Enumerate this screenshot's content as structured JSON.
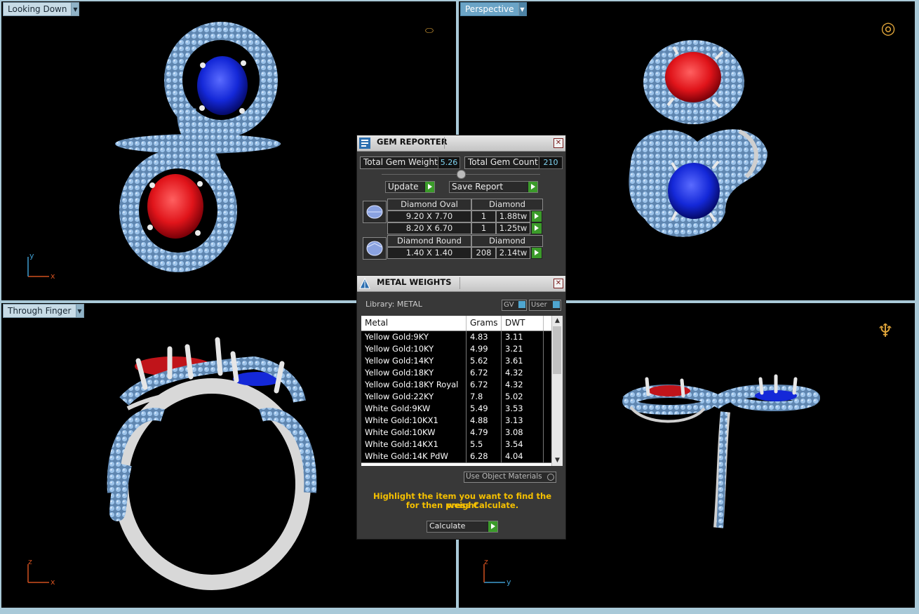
{
  "viewports": {
    "top_left": {
      "label": "Looking Down",
      "axes": [
        "y",
        "x"
      ]
    },
    "top_right": {
      "label": "Perspective"
    },
    "bottom_left": {
      "label": "Through Finger",
      "axes": [
        "z",
        "x"
      ]
    },
    "bottom_right": {
      "axes": [
        "z",
        "y"
      ]
    }
  },
  "gem_reporter": {
    "title": "GEM REPORTER",
    "total_weight_label": "Total Gem Weight",
    "total_weight_value": "5.26",
    "total_count_label": "Total Gem Count",
    "total_count_value": "210",
    "update_label": "Update",
    "save_report_label": "Save Report",
    "groups": [
      {
        "shape": "Diamond Oval",
        "material": "Diamond",
        "rows": [
          {
            "size": "9.20 X 7.70",
            "count": "1",
            "weight": "1.88tw"
          },
          {
            "size": "8.20 X 6.70",
            "count": "1",
            "weight": "1.25tw"
          }
        ]
      },
      {
        "shape": "Diamond Round",
        "material": "Diamond",
        "rows": [
          {
            "size": "1.40 X 1.40",
            "count": "208",
            "weight": "2.14tw"
          }
        ]
      }
    ]
  },
  "metal_weights": {
    "title": "METAL WEIGHTS",
    "library_label": "Library: METAL",
    "gv_label": "GV",
    "user_label": "User",
    "columns": [
      "Metal",
      "Grams",
      "DWT"
    ],
    "rows": [
      {
        "metal": "Yellow Gold:9KY",
        "grams": "4.83",
        "dwt": "3.11"
      },
      {
        "metal": "Yellow Gold:10KY",
        "grams": "4.99",
        "dwt": "3.21"
      },
      {
        "metal": "Yellow Gold:14KY",
        "grams": "5.62",
        "dwt": "3.61"
      },
      {
        "metal": "Yellow Gold:18KY",
        "grams": "6.72",
        "dwt": "4.32"
      },
      {
        "metal": "Yellow Gold:18KY Royal",
        "grams": "6.72",
        "dwt": "4.32"
      },
      {
        "metal": "Yellow Gold:22KY",
        "grams": "7.8",
        "dwt": "5.02"
      },
      {
        "metal": "White Gold:9KW",
        "grams": "5.49",
        "dwt": "3.53"
      },
      {
        "metal": "White Gold:10KX1",
        "grams": "4.88",
        "dwt": "3.13"
      },
      {
        "metal": "White Gold:10KW",
        "grams": "4.79",
        "dwt": "3.08"
      },
      {
        "metal": "White Gold:14KX1",
        "grams": "5.5",
        "dwt": "3.54"
      },
      {
        "metal": "White Gold:14K PdW",
        "grams": "6.28",
        "dwt": "4.04"
      }
    ],
    "use_object_materials_label": "Use Object Materials",
    "hint_line1": "Highlight the item you want to find the weight",
    "hint_line2": "for then press Calculate.",
    "calculate_label": "Calculate"
  },
  "colors": {
    "pave": "#8fb6e0",
    "ruby": "#e0141a",
    "sapphire": "#1428d8",
    "metal": "#d8d8d8",
    "accent_green": "#3b9b2a",
    "hint_yellow": "#f5c000"
  }
}
